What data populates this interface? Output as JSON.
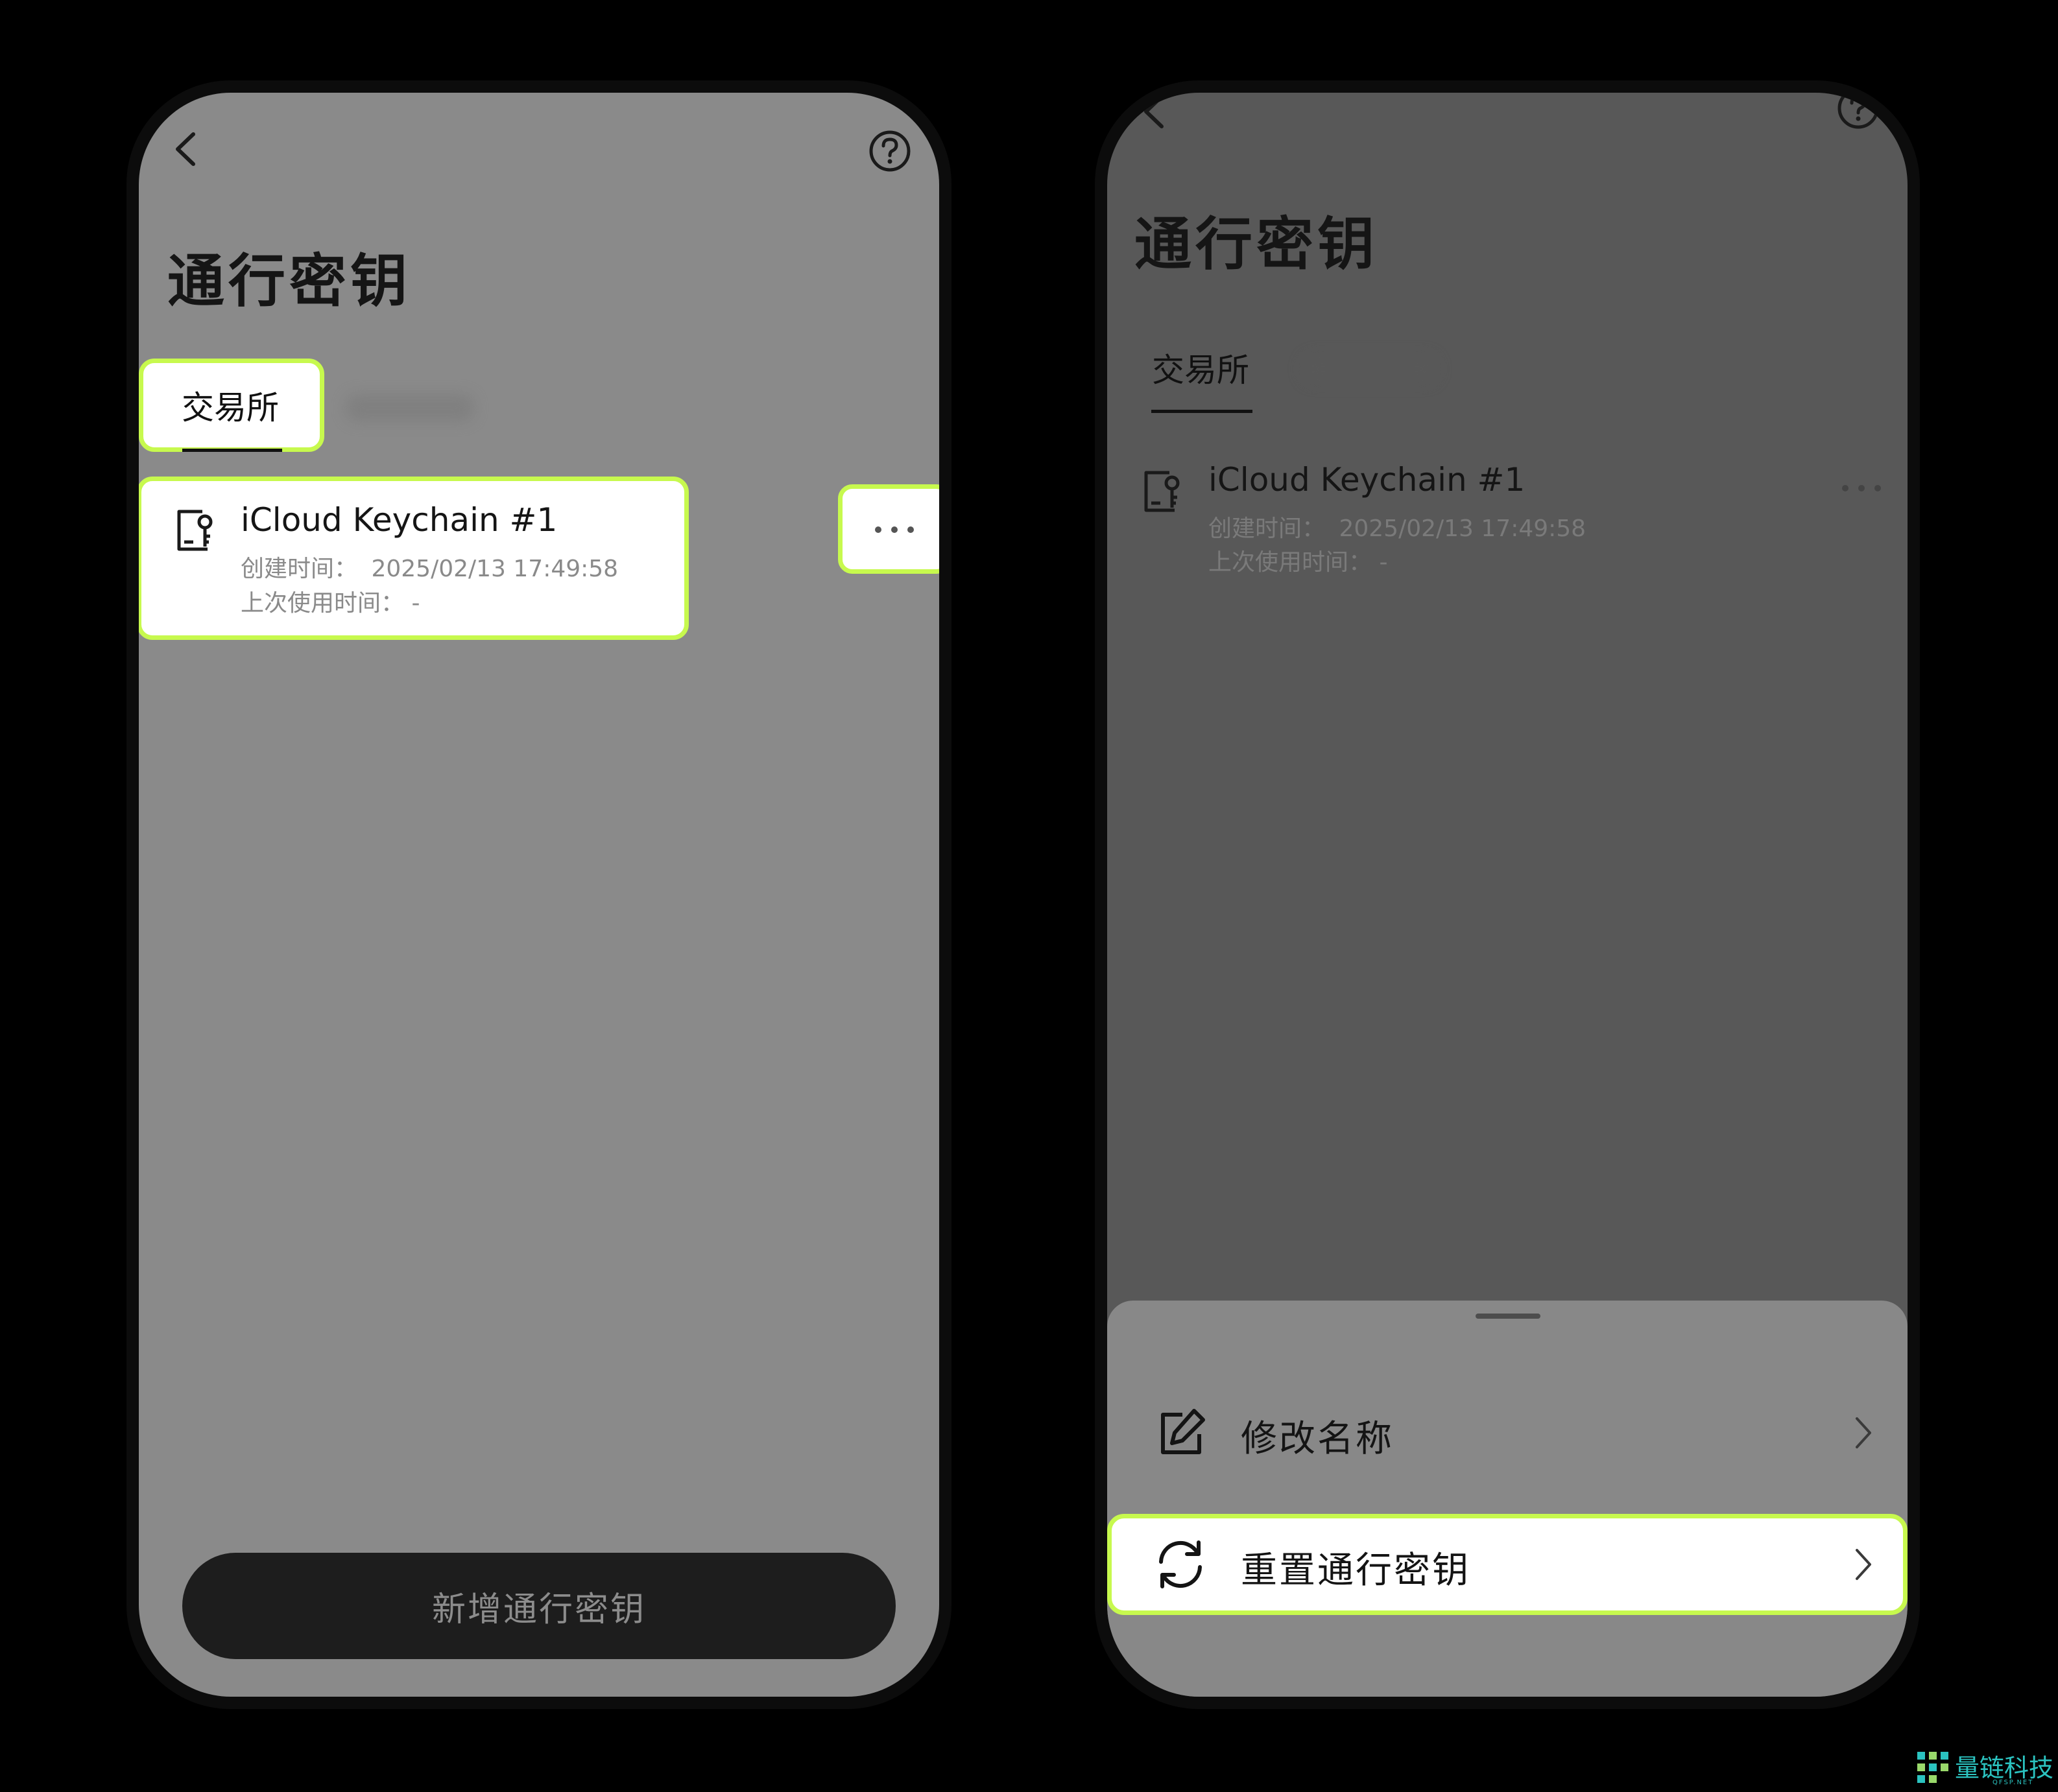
{
  "left_screen": {
    "title": "通行密钥",
    "tab_active": "交易所",
    "passkey": {
      "name": "iCloud Keychain #1",
      "created_label": "创建时间：",
      "created_value": "2025/02/13 17:49:58",
      "last_used_label": "上次使用时间：",
      "last_used_value": "-"
    },
    "add_button_label": "新增通行密钥"
  },
  "right_screen": {
    "title": "通行密钥",
    "tab_active": "交易所",
    "passkey": {
      "name": "iCloud Keychain #1",
      "created_label": "创建时间：",
      "created_value": "2025/02/13 17:49:58",
      "last_used_label": "上次使用时间：",
      "last_used_value": "-"
    },
    "sheet": {
      "items": [
        {
          "label": "修改名称",
          "icon": "edit-icon"
        },
        {
          "label": "重置通行密钥",
          "icon": "refresh-icon"
        }
      ]
    }
  },
  "watermark": {
    "text": "量链科技",
    "sub": "QFSP.NET"
  },
  "colors": {
    "highlight": "#c7f94e",
    "left_background": "#8a8a8a",
    "right_background": "#585858",
    "sheet_background": "#888888",
    "button_background": "#1d1d1d"
  }
}
